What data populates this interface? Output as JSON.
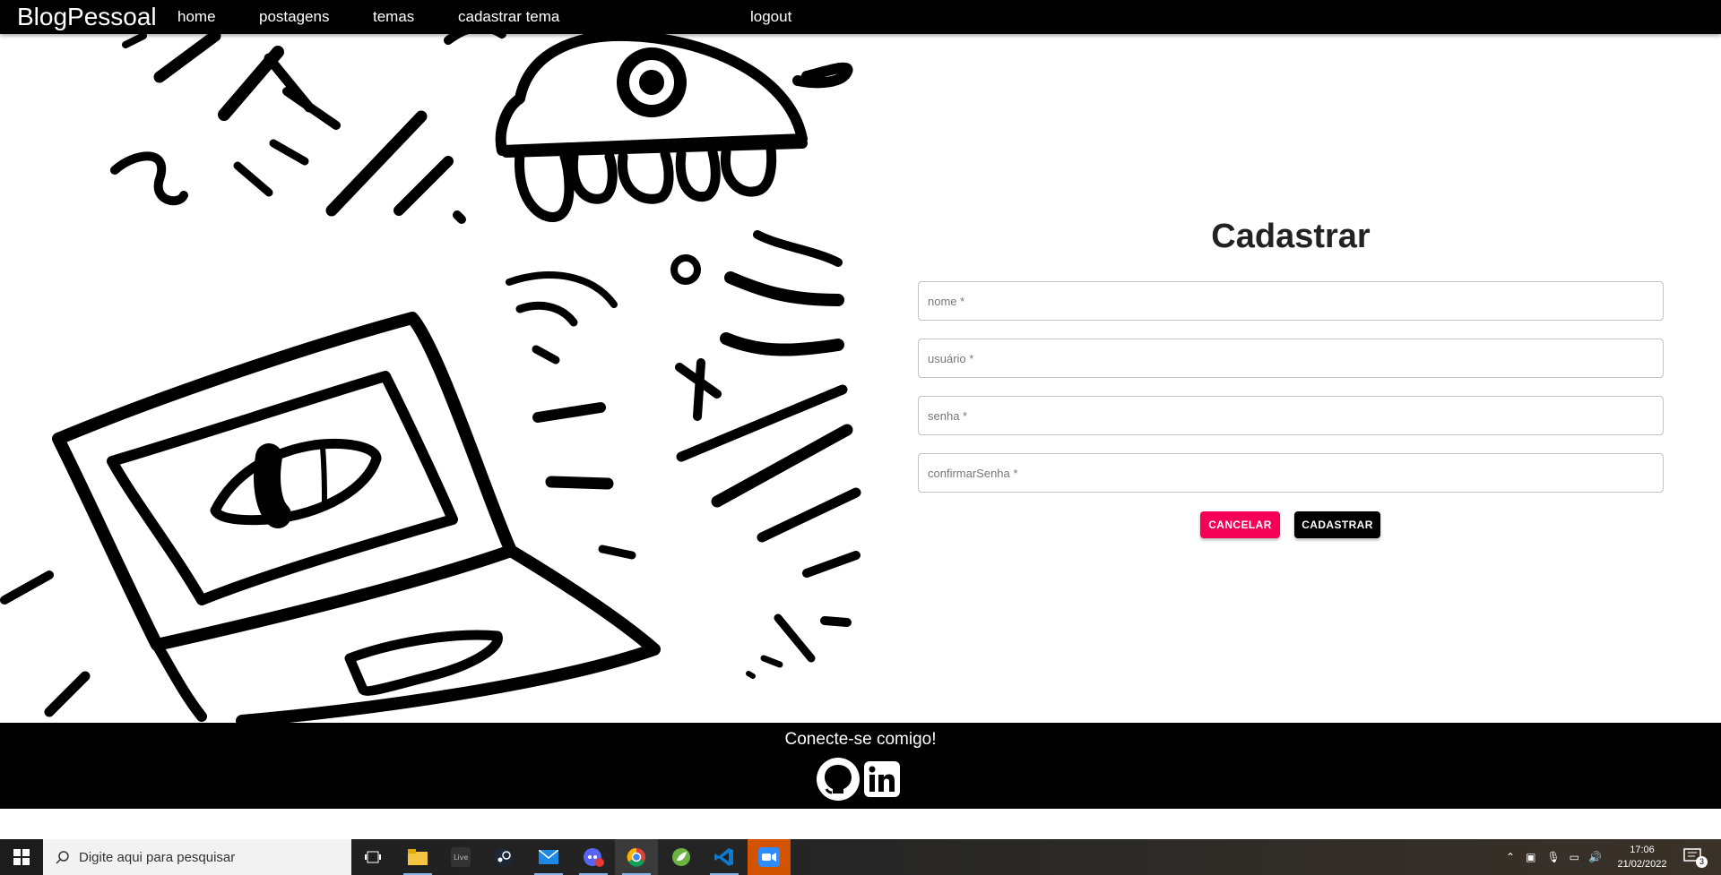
{
  "navbar": {
    "brand": "BlogPessoal",
    "links": [
      "home",
      "postagens",
      "temas",
      "cadastrar tema"
    ],
    "logout": "logout"
  },
  "form": {
    "title": "Cadastrar",
    "fields": [
      {
        "placeholder": "nome *"
      },
      {
        "placeholder": "usuário *"
      },
      {
        "placeholder": "senha *"
      },
      {
        "placeholder": "confirmarSenha *"
      }
    ],
    "cancel_label": "CANCELAR",
    "submit_label": "CADASTRAR",
    "colors": {
      "cancel": "#f50057",
      "submit": "#000000"
    }
  },
  "footer": {
    "text": "Conecte-se comigo!",
    "icons": [
      "github-icon",
      "linkedin-icon"
    ]
  },
  "taskbar": {
    "search_placeholder": "Digite aqui para pesquisar",
    "apps": [
      "task-view-icon",
      "file-explorer-icon",
      "live-icon",
      "steam-icon",
      "mail-icon",
      "discord-icon",
      "chrome-icon",
      "spring-icon",
      "vscode-icon",
      "zoom-icon"
    ],
    "time": "17:06",
    "date": "21/02/2022",
    "notifications": "3"
  }
}
